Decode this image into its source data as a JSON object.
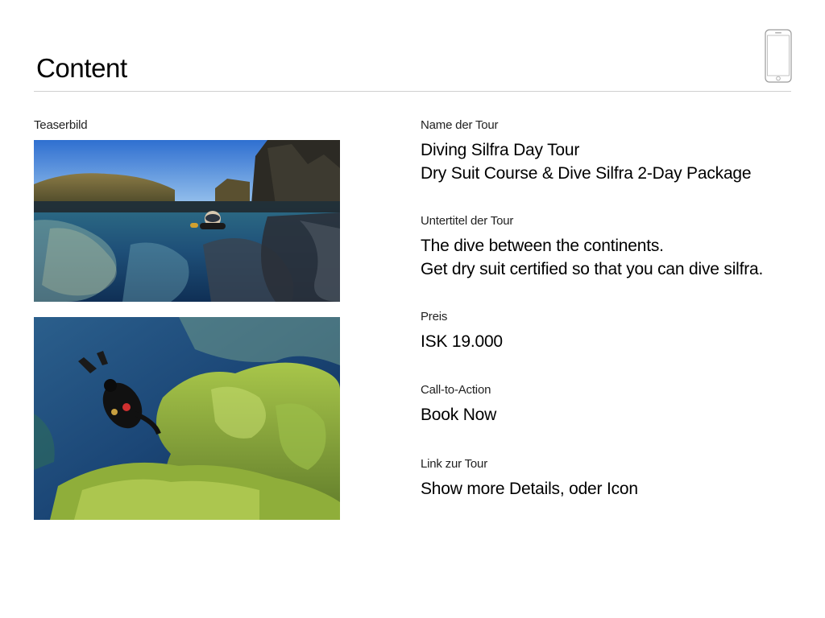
{
  "page": {
    "title": "Content"
  },
  "device_icon": "smartphone-icon",
  "teaser": {
    "label": "Teaserbild",
    "images": [
      "silfra-split-view-photo",
      "silfra-diver-algae-photo"
    ]
  },
  "fields": {
    "name": {
      "label": "Name der Tour",
      "lines": [
        "Diving Silfra Day Tour",
        "Dry Suit Course & Dive Silfra 2-Day Package"
      ]
    },
    "subtitle": {
      "label": "Untertitel der Tour",
      "lines": [
        "The dive between the continents.",
        "Get dry suit certified so that you can dive silfra."
      ]
    },
    "price": {
      "label": "Preis",
      "value": "ISK 19.000"
    },
    "cta": {
      "label": "Call-to-Action",
      "value": "Book Now"
    },
    "link": {
      "label": "Link zur Tour",
      "value": "Show more Details, oder Icon"
    }
  }
}
